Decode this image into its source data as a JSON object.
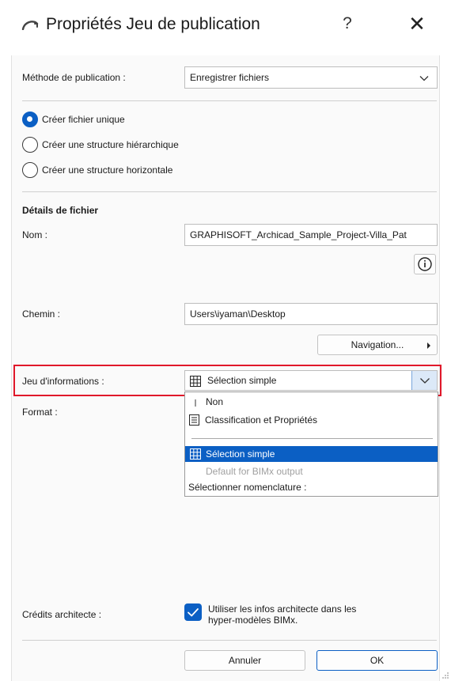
{
  "window": {
    "title": "Propriétés Jeu de publication",
    "help": "?",
    "close": "✕"
  },
  "method": {
    "label": "Méthode de publication :",
    "value": "Enregistrer fichiers"
  },
  "structure": {
    "options": [
      "Créer fichier unique",
      "Créer une structure hiérarchique",
      "Créer une structure horizontale"
    ],
    "selected_index": 0
  },
  "details": {
    "heading": "Détails de fichier",
    "name_label": "Nom :",
    "name_value": "GRAPHISOFT_Archicad_Sample_Project-Villa_Pat",
    "path_label": "Chemin :",
    "path_value": "Users\\iyaman\\Desktop",
    "navigation_button": "Navigation...",
    "info_set_label": "Jeu d'informations :",
    "info_set_value": "Sélection simple",
    "format_label": "Format :"
  },
  "info_set_dropdown": {
    "items": [
      {
        "label": "Non",
        "icon": "none-bar-icon",
        "enabled": true,
        "selected": false
      },
      {
        "label": "Classification et Propriétés",
        "icon": "document-list-icon",
        "enabled": true,
        "selected": false
      },
      {
        "label": "Sélection simple",
        "icon": "table-grid-icon",
        "enabled": true,
        "selected": true
      },
      {
        "label": "Default for BIMx output",
        "icon": "",
        "enabled": false,
        "selected": false
      },
      {
        "label": "Sélectionner nomenclature :",
        "icon": "",
        "enabled": true,
        "selected": false
      }
    ]
  },
  "architect": {
    "label": "Crédits architecte :",
    "checkbox_line1": "Utiliser les infos architecte dans les",
    "checkbox_line2": "hyper-modèles BIMx.",
    "checked": true
  },
  "footer": {
    "cancel": "Annuler",
    "ok": "OK"
  },
  "colors": {
    "accent": "#0b5fc4",
    "highlight_border": "#e0182a"
  }
}
